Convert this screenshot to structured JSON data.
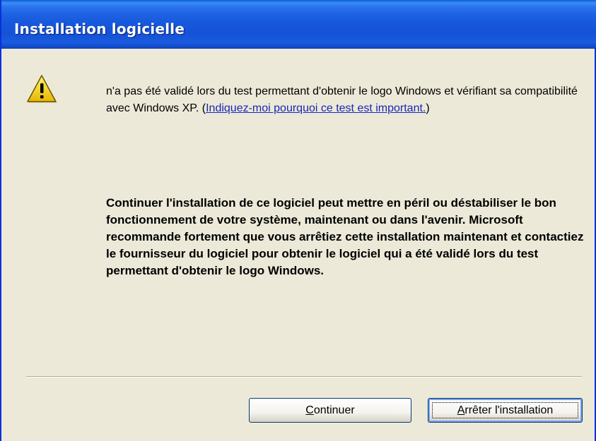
{
  "window": {
    "title": "Installation logicielle"
  },
  "icon": {
    "name": "warning-icon",
    "color": "#f5d000"
  },
  "message": {
    "line_text": "n'a pas été validé lors du test permettant d'obtenir le logo Windows et vérifiant sa compatibilité avec Windows XP. (",
    "link": "Indiquez-moi pourquoi ce test est important.",
    "close_paren": ")"
  },
  "warning": {
    "text": "Continuer l'installation de ce logiciel peut mettre en péril ou déstabiliser le bon fonctionnement de votre système, maintenant ou dans l'avenir. Microsoft recommande fortement que vous arrêtiez cette installation maintenant et contactiez le fournisseur du logiciel pour obtenir le logiciel qui a été validé lors du test permettant d'obtenir le logo Windows."
  },
  "buttons": {
    "continue_accel": "C",
    "continue_rest": "ontinuer",
    "stop_accel": "A",
    "stop_rest": "rrêter l'installation"
  },
  "colors": {
    "titlebar": "#1d62e3",
    "background": "#ece9d8",
    "link": "#1a26b8"
  }
}
